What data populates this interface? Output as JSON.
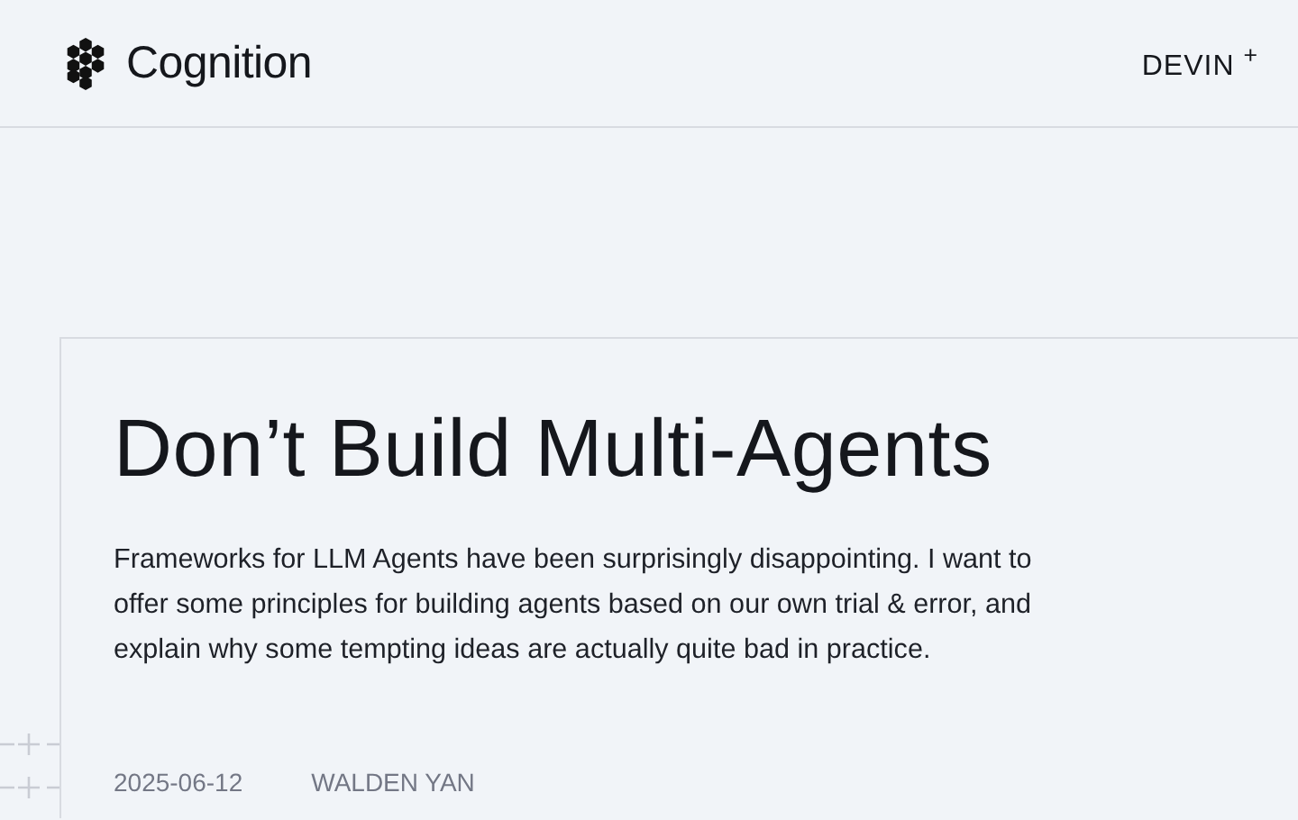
{
  "header": {
    "logo_text": "Cognition",
    "nav_link": "DEVIN $^{+}$"
  },
  "article": {
    "title": "Don’t Build Multi-Agents",
    "summary": "Frameworks for LLM Agents have been surprisingly disappointing. I want to offer some principles for building agents based on our own trial & error, and explain why some tempting ideas are actually quite bad in practice.",
    "date": "2025-06-12",
    "author": "WALDEN YAN"
  }
}
